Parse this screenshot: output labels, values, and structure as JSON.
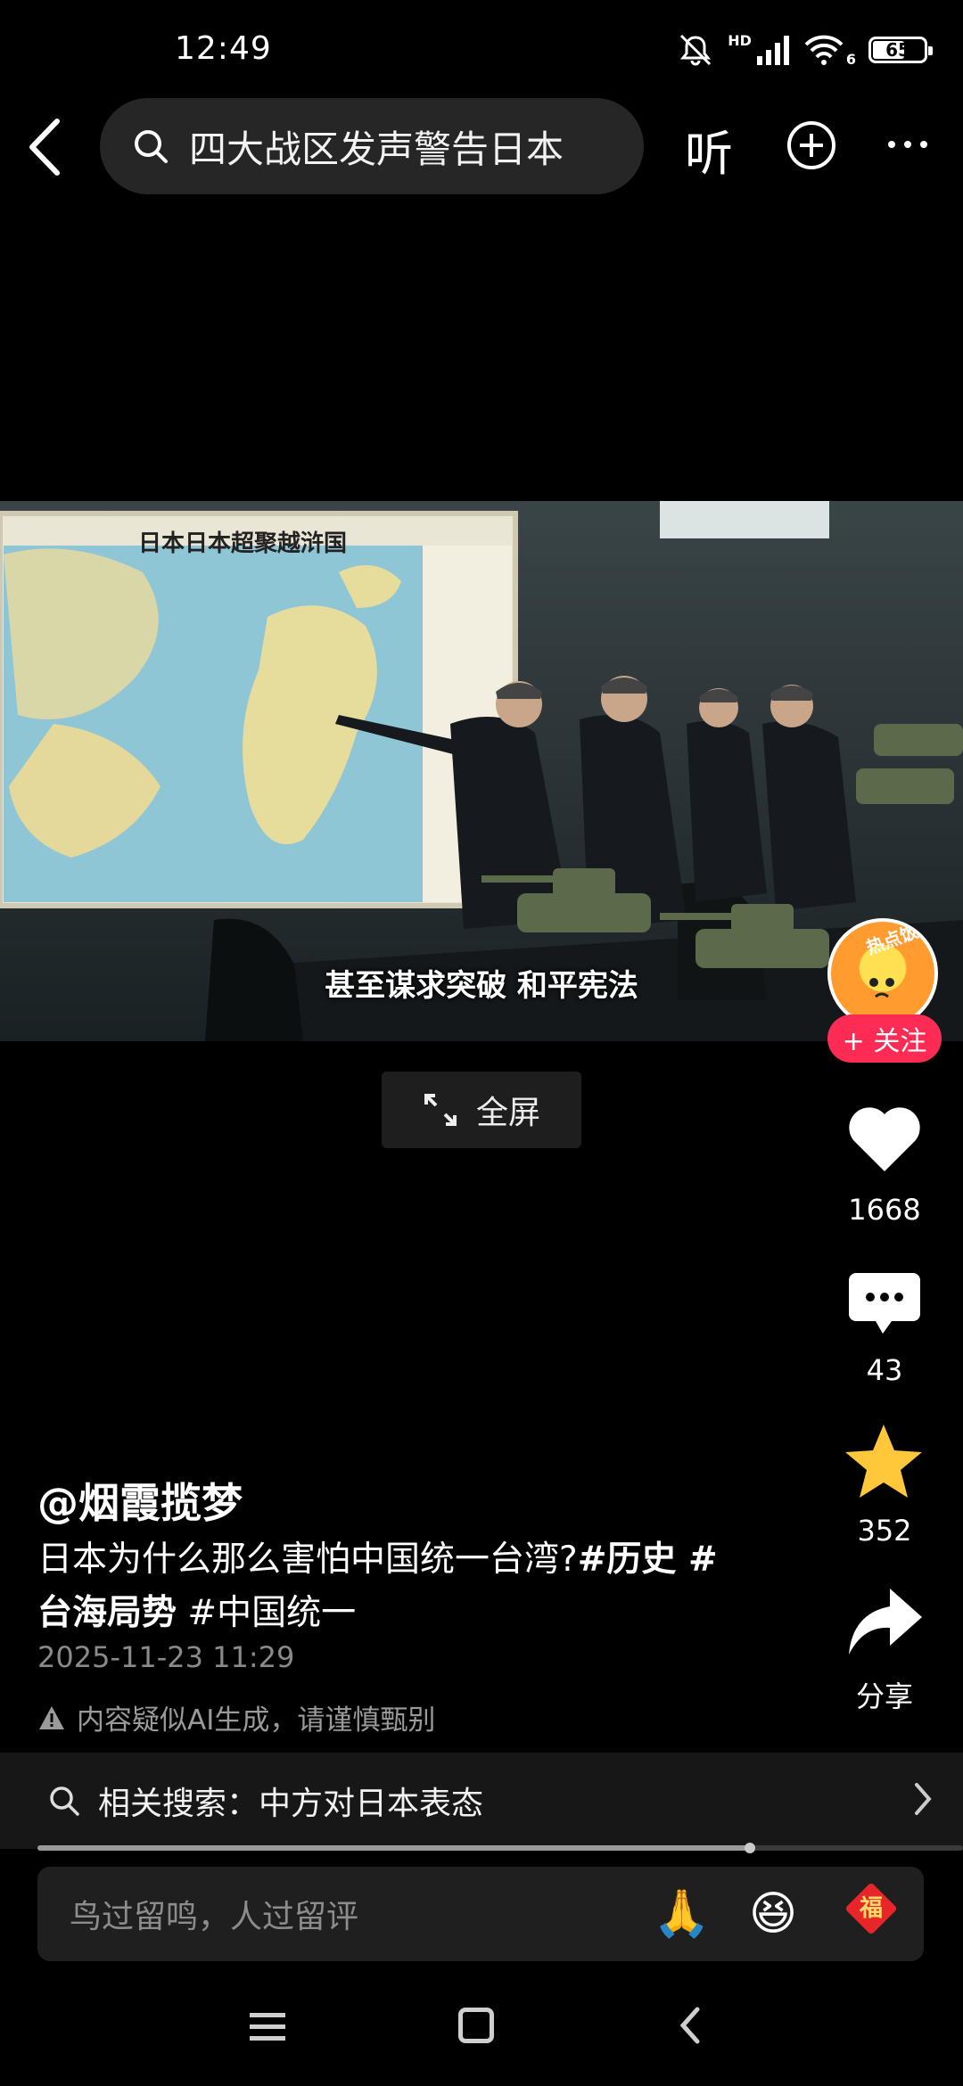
{
  "status_bar": {
    "time": "12:49",
    "network": "HD",
    "wifi_label": "6",
    "battery": "65",
    "battery_level": 0.65
  },
  "top_bar": {
    "search_text": "四大战区发声警告日本",
    "listen_label": "听",
    "icons": [
      "back-arrow-icon",
      "search-icon",
      "plus-circle-icon",
      "more-icon"
    ]
  },
  "video": {
    "map_title": "日本日本超聚越浒国",
    "subtitle": "甚至谋求突破 和平宪法",
    "fullscreen_label": "全屏"
  },
  "rail": {
    "avatar_badge": "热点饭",
    "follow_label": "+ 关注",
    "likes": "1668",
    "comments": "43",
    "favorites": "352",
    "share_label": "分享",
    "colors": {
      "like": "#ffffff",
      "favorite": "#ffc83a",
      "follow": "#fe2c55"
    }
  },
  "post": {
    "author": "@烟霞揽梦",
    "caption_text": "日本为什么那么害怕中国统一台湾?",
    "tag1": "#历史 #",
    "tag2": "台海局势",
    "tag3": "#中国统一",
    "date": "2025-11-23 11:29",
    "ai_warning": "内容疑似AI生成，请谨慎甄别"
  },
  "related": {
    "label": "相关搜索：中方对日本表态"
  },
  "progress": {
    "fraction": 0.77
  },
  "comment": {
    "placeholder": "鸟过留鸣，人过留评",
    "emojis": [
      "🙏",
      "😆"
    ],
    "fu_label": "福"
  },
  "system_nav": {
    "icons": [
      "menu-icon",
      "home-icon",
      "back-icon"
    ]
  }
}
